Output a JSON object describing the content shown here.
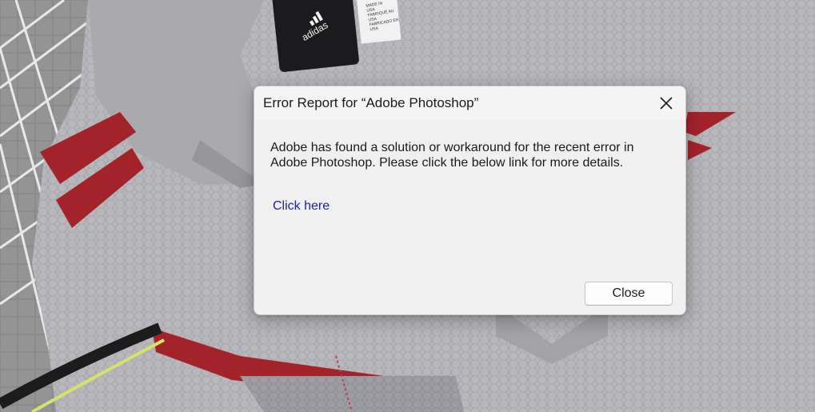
{
  "dialog": {
    "title": "Error Report for “Adobe Photoshop”",
    "message": "Adobe has found a solution or workaround for the recent error in Adobe Photoshop. Please click the below link for more details.",
    "link_text": "Click here",
    "close_button_label": "Close",
    "close_icon": "close-icon"
  },
  "wallpaper": {
    "label_brand_text": "adidas",
    "label_fine_print": [
      "MADE IN",
      "USA",
      "FABRIQUÉ AU",
      "USA",
      "FABRICADO EN",
      "USA"
    ]
  },
  "colors": {
    "dialog_background": "#f0f0f0",
    "link": "#1f1f9b",
    "shirt": "#b8b8bd",
    "stripe": "#a3232a"
  }
}
